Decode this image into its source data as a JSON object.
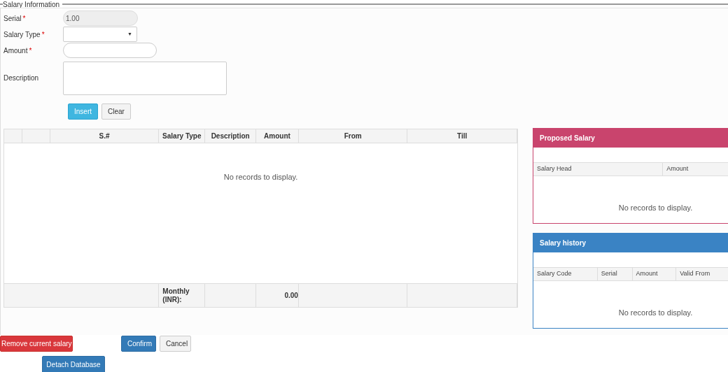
{
  "legend": "Salary Information",
  "form": [
    {
      "kind": "readonly",
      "label": "Serial",
      "mark": "*",
      "value": "1.00"
    },
    {
      "kind": "select",
      "label": "Salary Type",
      "mark": "*",
      "caret": "▼"
    },
    {
      "kind": "text",
      "label": "Amount",
      "mark": "*"
    },
    {
      "kind": "textarea",
      "label": "Description"
    }
  ],
  "form_buttons": [
    {
      "label": "Insert",
      "kind": "primary"
    },
    {
      "label": "Clear",
      "kind": "default"
    }
  ],
  "grid": {
    "columns": [
      null,
      null,
      "S.#",
      "Salary Type",
      "Description",
      "Amount",
      "From",
      "Till"
    ],
    "empty_text": "No records to display.",
    "footer": {
      "label": "Monthly (INR):",
      "amount": "0.00"
    }
  },
  "panels": [
    {
      "title": "Proposed Salary",
      "color": "#c9446d",
      "columns": [
        "Salary Head",
        "Amount"
      ],
      "empty_text": "No records to display."
    },
    {
      "title": "Salary history",
      "color": "#3a83c4",
      "columns": [
        "Salary Code",
        "Serial",
        "Amount",
        "Valid From"
      ],
      "empty_text": "No records to display."
    }
  ],
  "actions": [
    {
      "label": "Remove current salary",
      "kind": "danger"
    },
    {
      "label": "Confirm",
      "kind": "primary"
    },
    {
      "label": "Cancel",
      "kind": "default"
    }
  ],
  "bottom_buttons": [
    {
      "label": "Detach Database",
      "kind": "primary"
    }
  ]
}
